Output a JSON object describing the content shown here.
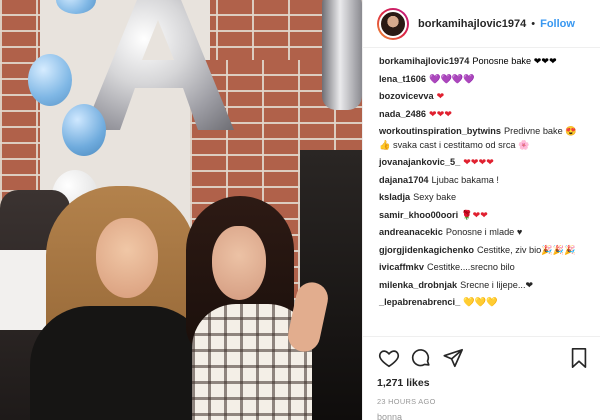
{
  "post": {
    "username": "borkamihajlovic1974",
    "follow_label": "Follow",
    "separator": "•"
  },
  "comments": [
    {
      "user": "borkamihajlovic1974",
      "text": "Ponosne bake ❤❤❤",
      "color": "#000000"
    },
    {
      "user": "lena_t1606",
      "text": "💜💜💜💜",
      "color": "#8a55c9"
    },
    {
      "user": "bozovicevva",
      "text": "❤",
      "color": "#e0202f"
    },
    {
      "user": "nada_2486",
      "text": "❤❤❤",
      "color": "#e0202f"
    },
    {
      "user": "workoutinspiration_bytwins",
      "text": "Predivne bake 😍👍 svaka cast i cestitamo od srca 🌸",
      "color": "#262626"
    },
    {
      "user": "jovanajankovic_5_",
      "text": "❤❤❤❤",
      "color": "#e0202f"
    },
    {
      "user": "dajana1704",
      "text": "Ljubac bakama !",
      "color": "#262626"
    },
    {
      "user": "ksladja",
      "text": "Sexy bake",
      "color": "#262626"
    },
    {
      "user": "samir_khoo00oori",
      "text": "🌹❤❤",
      "color": "#e0202f"
    },
    {
      "user": "andreanacekic",
      "text": "Ponosne i mlade ♥",
      "color": "#262626"
    },
    {
      "user": "gjorgjidenkagichenko",
      "text": "Cestitke, ziv bio🎉🎉🎉",
      "color": "#262626"
    },
    {
      "user": "ivicaffmkv",
      "text": "Cestitke....srecno bilo",
      "color": "#262626"
    },
    {
      "user": "milenka_drobnjak",
      "text": "Srecne i lijepe...❤",
      "color": "#262626"
    },
    {
      "user": "_lepabrenabrenci_",
      "text": "💛💛💛",
      "color": "#f2b600"
    }
  ],
  "actions": {
    "like_icon": "heart-outline-icon",
    "comment_icon": "comment-bubble-icon",
    "share_icon": "paper-plane-icon",
    "save_icon": "bookmark-icon"
  },
  "likes": "1,271 likes",
  "timestamp": "23 HOURS AGO",
  "truncated_next_comment": "bonna"
}
